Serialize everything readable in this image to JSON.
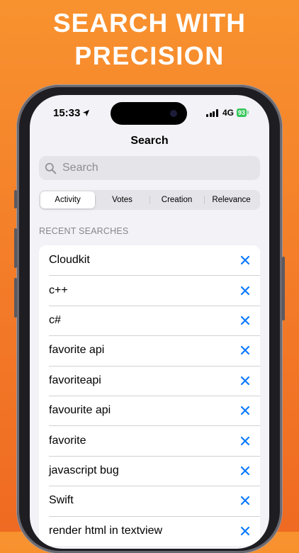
{
  "headline": {
    "line1": "SEARCH WITH",
    "line2": "PRECISION"
  },
  "status_bar": {
    "time": "15:33",
    "network": "4G",
    "battery": "93"
  },
  "nav": {
    "title": "Search"
  },
  "search": {
    "placeholder": "Search"
  },
  "sort_tabs": [
    {
      "label": "Activity",
      "selected": true
    },
    {
      "label": "Votes",
      "selected": false
    },
    {
      "label": "Creation",
      "selected": false
    },
    {
      "label": "Relevance",
      "selected": false
    }
  ],
  "recent": {
    "header": "RECENT SEARCHES",
    "items": [
      "Cloudkit",
      "c++",
      "c#",
      "favorite api",
      "favoriteapi",
      "favourite api",
      "favorite",
      "javascript bug",
      "Swift",
      "render html in textview"
    ]
  },
  "colors": {
    "background_top": "#f8922f",
    "background_bottom": "#ef6a22",
    "accent_blue": "#0a7aff",
    "battery_green": "#34c759"
  }
}
